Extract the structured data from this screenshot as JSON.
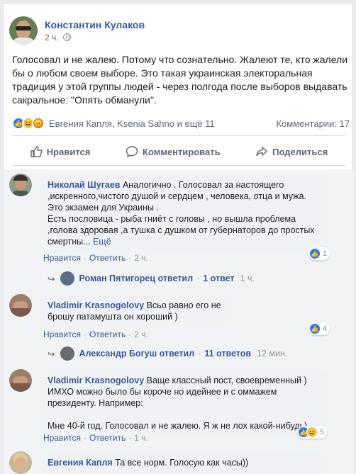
{
  "post": {
    "author": "Константин Кулаков",
    "time": "2 ч.",
    "text": "Голосовал и не жалею. Потому что сознательно. Жалеют те, кто жалели бы о любом своем выборе. Это такая украинская электоральная традиция у этой группы людей - через полгода после выборов выдавать сакральное: \"Опять обманули\".",
    "reaction_names": "Евгения Капля, Ksenia Sahno и ещё 11",
    "comments_count": "Комментарии: 17"
  },
  "actions": {
    "like": "Нравится",
    "comment": "Комментировать",
    "share": "Поделиться"
  },
  "comments": [
    {
      "author": "Николай Шугаев",
      "text": "Аналогично . Голосовал за настоящего ,искренного,чистого душой и сердцем , человека, отца и мужа. Это экзамен для Украины .\nЕсть пословица - рыба гниёт с головы , но вышла проблема ,голова здоровая ,а тушка с душком от губернаторов до простых смертны...",
      "more": "Ещё",
      "like": "Нравится",
      "reply": "Ответить",
      "time": "2 ч.",
      "reactions": "1"
    },
    {
      "author": "Vladimir Krasnogolovy",
      "text": "Всьо равно его не брошу патамушта он хороший )",
      "like": "Нравится",
      "reply": "Ответить",
      "time": "2 ч.",
      "reactions": "4"
    },
    {
      "author": "Vladimir Krasnogolovy",
      "text": "Ваще классный пост, своевременный ) ИМХО можно было бы короче но идейнее и с оммажем президенту. Например:\n\nМне 40-й год. Голосовал и не жалею. Я ж не лох какой-нибудь)",
      "like": "Нравится",
      "reply": "Ответить",
      "time": "1 ч.",
      "reactions": "5"
    },
    {
      "author": "Евгения Капля",
      "text": "Та все норм. Голосую как часы))"
    }
  ],
  "replies": [
    {
      "who": "Роман Пятигорец ответил",
      "count": "1 ответ",
      "time": "1 ч."
    },
    {
      "who": "Александр Богуш ответил",
      "count": "11 ответов",
      "time": "12 мин."
    }
  ],
  "colors": {
    "link": "#385898",
    "like_blue": "#2078f4",
    "haha_yellow": "#f7c34a",
    "angry_orange": "#e9710f"
  }
}
